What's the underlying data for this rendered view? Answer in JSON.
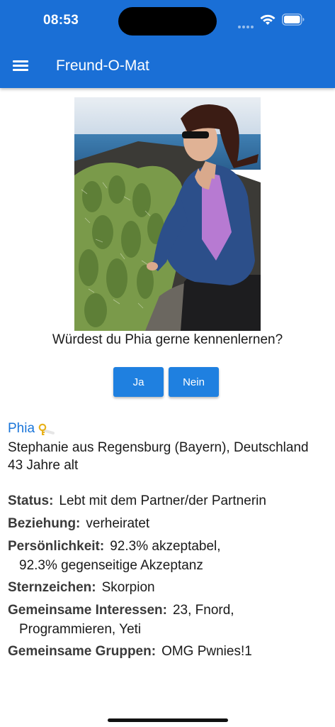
{
  "status_bar": {
    "time": "08:53"
  },
  "app_bar": {
    "title": "Freund-O-Mat"
  },
  "prompt": {
    "question": "Würdest du Phia gerne kennenlernen?",
    "yes_label": "Ja",
    "no_label": "Nein"
  },
  "profile": {
    "name": "Phia",
    "location": "Stephanie aus Regensburg (Bayern), Deutschland",
    "age": "43 Jahre alt",
    "details": [
      {
        "label": "Status:",
        "value": "Lebt mit dem Partner/der Partnerin"
      },
      {
        "label": "Beziehung:",
        "value": "verheiratet"
      },
      {
        "label": "Persönlichkeit:",
        "value": "92.3% akzeptabel,",
        "value2": "92.3% gegenseitige Akzeptanz"
      },
      {
        "label": "Sternzeichen:",
        "value": "Skorpion"
      },
      {
        "label": "Gemeinsame Interessen:",
        "value": "23, Fnord,",
        "value2": "Programmieren, Yeti"
      },
      {
        "label": "Gemeinsame Gruppen:",
        "value": "OMG Pwnies!1"
      }
    ]
  },
  "colors": {
    "app_bar": "#1a6fd6",
    "button": "#1f80e0",
    "name_link": "#1a75d9"
  },
  "icons": [
    "menu-icon",
    "wifi-icon",
    "battery-icon",
    "signal-icon",
    "key-icon"
  ]
}
